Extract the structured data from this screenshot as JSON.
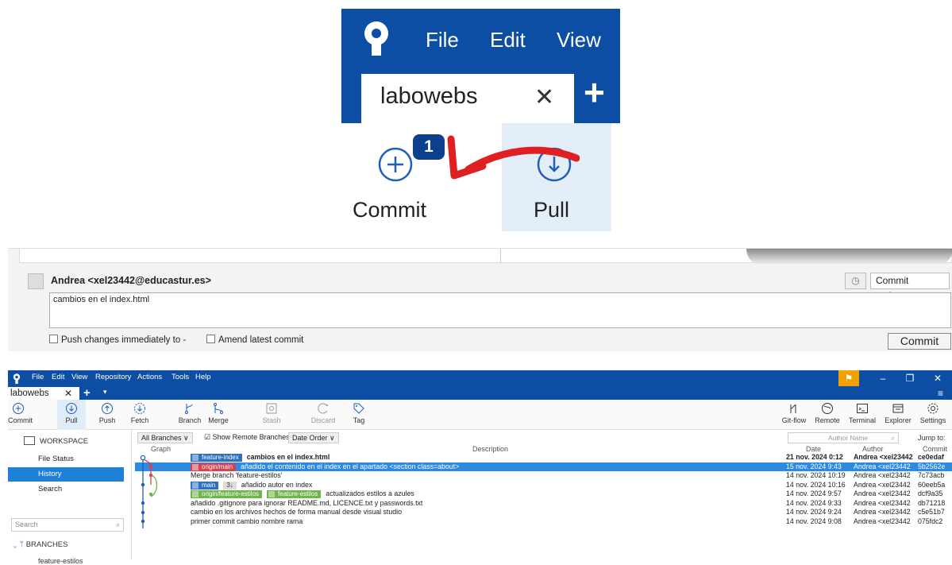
{
  "zoom": {
    "menu": [
      "File",
      "Edit",
      "View"
    ],
    "tab_label": "labowebs",
    "commit_label": "Commit",
    "commit_badge": "1",
    "pull_label": "Pull"
  },
  "commit_panel": {
    "author": "Andrea <xel23442@educastur.es>",
    "commit_options": "Commit options... ∨",
    "message": "cambios en el index.html",
    "push_immediately": "Push changes immediately to -",
    "amend": "Amend latest commit",
    "commit_button": "Commit"
  },
  "app": {
    "menu": [
      "File",
      "Edit",
      "View",
      "Repository",
      "Actions",
      "Tools",
      "Help"
    ],
    "tab_label": "labowebs",
    "toolbar_left": [
      {
        "label": "Commit",
        "icon": "plus-circle-icon"
      },
      {
        "label": "Pull",
        "icon": "arrow-down-circle-icon"
      },
      {
        "label": "Push",
        "icon": "arrow-up-circle-icon"
      },
      {
        "label": "Fetch",
        "icon": "fetch-icon"
      },
      {
        "label": "Branch",
        "icon": "branch-icon"
      },
      {
        "label": "Merge",
        "icon": "merge-icon"
      },
      {
        "label": "Stash",
        "icon": "stash-icon"
      },
      {
        "label": "Discard",
        "icon": "discard-icon"
      },
      {
        "label": "Tag",
        "icon": "tag-icon"
      }
    ],
    "toolbar_right": [
      {
        "label": "Git-flow",
        "icon": "git-flow-icon"
      },
      {
        "label": "Remote",
        "icon": "globe-icon"
      },
      {
        "label": "Terminal",
        "icon": "terminal-icon"
      },
      {
        "label": "Explorer",
        "icon": "folder-icon"
      },
      {
        "label": "Settings",
        "icon": "gear-icon"
      }
    ],
    "sidebar": {
      "workspace": "WORKSPACE",
      "items": [
        "File Status",
        "History",
        "Search"
      ],
      "search_placeholder": "Search",
      "branches": "BRANCHES",
      "first_branch": "feature-estilos"
    },
    "filters": {
      "branches": "All Branches ∨",
      "show_remote": "Show Remote Branches",
      "order": "Date Order ∨",
      "author_placeholder": "Author Name",
      "jump": "Jump to:"
    },
    "columns": {
      "graph": "Graph",
      "description": "Description",
      "date": "Date",
      "author": "Author",
      "commit": "Commit"
    },
    "rows": [
      {
        "tags": [
          {
            "text": "feature-index",
            "color": "blue"
          }
        ],
        "desc": "cambios en el index.html",
        "date": "21 nov. 2024 0:12",
        "author": "Andrea <xel23442",
        "hash": "ce0edaf",
        "bold": true
      },
      {
        "tags": [
          {
            "text": "origin/main",
            "color": "red"
          }
        ],
        "desc": "añadido el contenido en el index en el apartado <section class=about>",
        "date": "15 nov. 2024 9:43",
        "author": "Andrea <xel23442",
        "hash": "5b2562e",
        "selected": true
      },
      {
        "tags": [],
        "desc": "Merge branch 'feature-estilos'",
        "date": "14 nov. 2024 10:19",
        "author": "Andrea <xel23442",
        "hash": "7c73acb"
      },
      {
        "tags": [
          {
            "text": "main",
            "color": "blue"
          },
          {
            "text": "3↓",
            "color": "grey"
          }
        ],
        "desc": "añadido autor en index",
        "date": "14 nov. 2024 10:16",
        "author": "Andrea <xel23442",
        "hash": "60eeb5a"
      },
      {
        "tags": [
          {
            "text": "origin/feature-estilos",
            "color": "green"
          },
          {
            "text": "feature-estilos",
            "color": "green"
          }
        ],
        "desc": "actualizados estilos a azules",
        "date": "14 nov. 2024 9:57",
        "author": "Andrea <xel23442",
        "hash": "dcf9a35"
      },
      {
        "tags": [],
        "desc": "añadido .gitignore para ignorar README.md, LICENCE.txt y passwords.txt",
        "date": "14 nov. 2024 9:33",
        "author": "Andrea <xel23442",
        "hash": "db71218"
      },
      {
        "tags": [],
        "desc": "cambio en los archivos hechos de forma manual desde visual studio",
        "date": "14 nov. 2024 9:24",
        "author": "Andrea <xel23442",
        "hash": "c5e51b7"
      },
      {
        "tags": [],
        "desc": "primer commit cambio nombre rama",
        "date": "14 nov. 2024 9:08",
        "author": "Andrea <xel23442",
        "hash": "075fdc2"
      }
    ],
    "window_buttons": [
      "⚑",
      "–",
      "❐",
      "✕"
    ],
    "colors": {
      "brand": "#0c4ea3",
      "selection": "#2c8ae0",
      "arrow": "#e02020",
      "flag": "#f2a100"
    }
  }
}
